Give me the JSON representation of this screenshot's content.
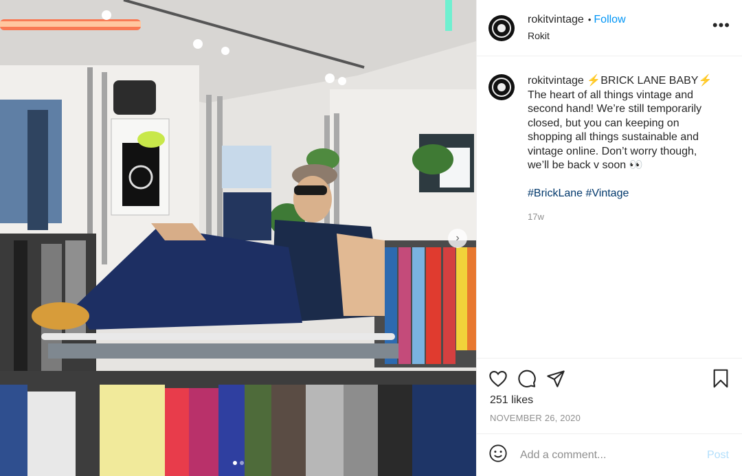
{
  "photo": {
    "description_icon": "store-photo",
    "carousel_next_icon": "chevron-right-icon",
    "slide_count": 2,
    "active_slide": 1
  },
  "header": {
    "username": "rokitvintage",
    "separator": "•",
    "follow_label": "Follow",
    "location": "Rokit",
    "more_label": "•••"
  },
  "caption": {
    "username": "rokitvintage",
    "text_lead": " ⚡BRICK LANE BABY⚡",
    "text_body": "The heart of all things vintage and second hand! We’re still temporarily closed, but you can keeping on shopping all things sustainable and vintage online. Don’t worry though, we’ll be back v soon 👀",
    "hashtags": [
      "#BrickLane",
      "#Vintage"
    ],
    "age": "17w"
  },
  "actions": {
    "likes": "251 likes",
    "date": "NOVEMBER 26, 2020"
  },
  "comment": {
    "placeholder": "Add a comment...",
    "post_label": "Post"
  },
  "colors": {
    "accent": "#0095f6",
    "post_disabled": "#b2dffc",
    "hashtag": "#00376b",
    "muted": "#8e8e8e"
  }
}
